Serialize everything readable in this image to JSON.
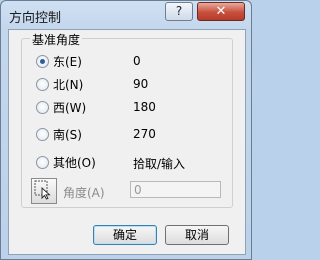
{
  "window": {
    "title": "方向控制",
    "help_label": "?",
    "close_label": "✕"
  },
  "group": {
    "title": "基准角度",
    "options": [
      {
        "label": "东(E)",
        "value": "0",
        "checked": true
      },
      {
        "label": "北(N)",
        "value": "90",
        "checked": false
      },
      {
        "label": "西(W)",
        "value": "180",
        "checked": false
      },
      {
        "label": "南(S)",
        "value": "270",
        "checked": false
      },
      {
        "label": "其他(O)",
        "value": "拾取/输入",
        "checked": false
      }
    ],
    "angle_label": "角度(A)",
    "angle_value": "0",
    "pick_icon": "pick-point-icon"
  },
  "buttons": {
    "ok": "确定",
    "cancel": "取消"
  }
}
